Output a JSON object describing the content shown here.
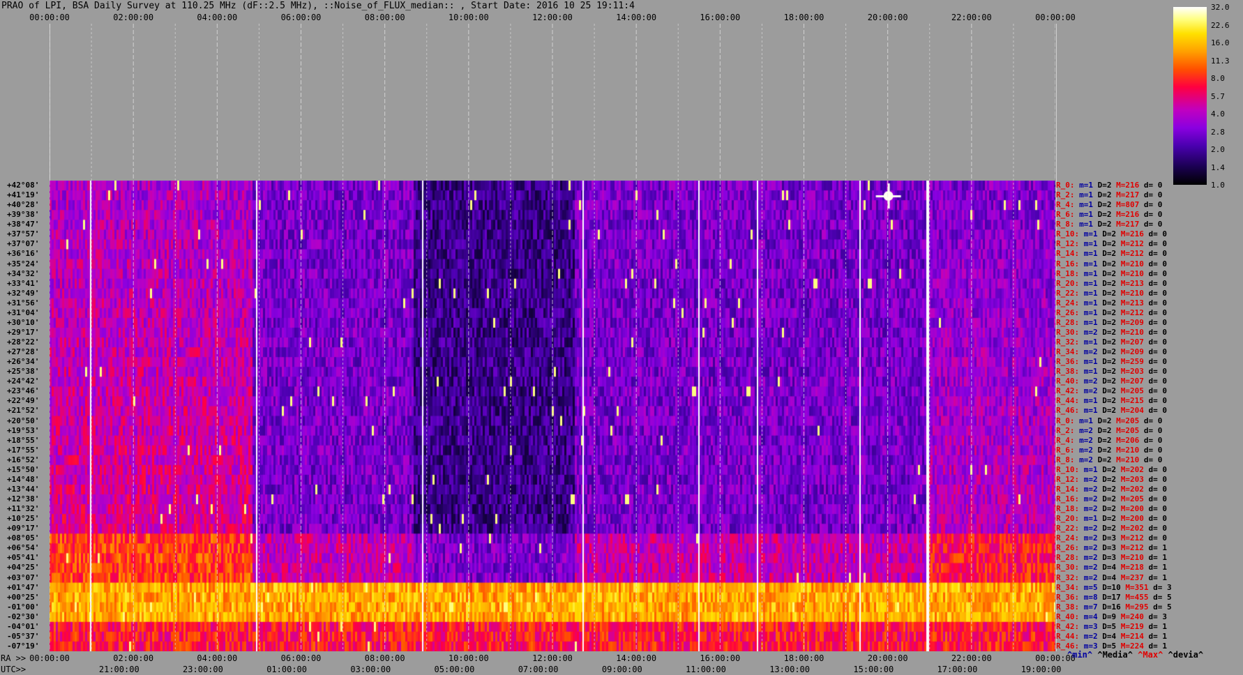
{
  "title": "PRAO of LPI, BSA Daily Survey at 110.25 MHz (dF::2.5 MHz), ::Noise_of_FLUX_median:: , Start Date: 2016 10 25 19:11:4",
  "top_axis": [
    "00:00:00",
    "02:00:00",
    "04:00:00",
    "06:00:00",
    "08:00:00",
    "10:00:00",
    "12:00:00",
    "14:00:00",
    "16:00:00",
    "18:00:00",
    "20:00:00",
    "22:00:00",
    "00:00:00"
  ],
  "bottom_axis_ra_label": "RA >>",
  "bottom_axis_ra": [
    "00:00:00",
    "02:00:00",
    "04:00:00",
    "06:00:00",
    "08:00:00",
    "10:00:00",
    "12:00:00",
    "14:00:00",
    "16:00:00",
    "18:00:00",
    "20:00:00",
    "22:00:00",
    "00:00:00"
  ],
  "bottom_axis_utc_label": "UTC>>",
  "bottom_axis_utc": [
    "21:00:00",
    "23:00:00",
    "01:00:00",
    "03:00:00",
    "05:00:00",
    "07:00:00",
    "09:00:00",
    "11:00:00",
    "13:00:00",
    "15:00:00",
    "17:00:00",
    "19:00:00"
  ],
  "colorbar_ticks": [
    "32.0",
    "22.6",
    "16.0",
    "11.3",
    "8.0",
    "5.7",
    "4.0",
    "2.8",
    "2.0",
    "1.4",
    "1.0"
  ],
  "stat_legend": {
    "min": "^min^",
    "median": "^Media^",
    "max": "^Max^",
    "dev": "^devia^"
  },
  "declinations": [
    "+42°08'",
    "+41°19'",
    "+40°28'",
    "+39°38'",
    "+38°47'",
    "+37°57'",
    "+37°07'",
    "+36°16'",
    "+35°24'",
    "+34°32'",
    "+33°41'",
    "+32°49'",
    "+31°56'",
    "+31°04'",
    "+30°10'",
    "+29°17'",
    "+28°22'",
    "+27°28'",
    "+26°34'",
    "+25°38'",
    "+24°42'",
    "+23°46'",
    "+22°49'",
    "+21°52'",
    "+20°50'",
    "+19°53'",
    "+18°55'",
    "+17°55'",
    "+16°52'",
    "+15°50'",
    "+14°48'",
    "+13°44'",
    "+12°38'",
    "+11°32'",
    "+10°25'",
    "+09°17'",
    "+08°05'",
    "+06°54'",
    "+05°41'",
    "+04°25'",
    "+03°07'",
    "+01°47'",
    "+00°25'",
    "-01°00'",
    "-02°30'",
    "-04°01'",
    "-05°37'",
    "-07°19'"
  ],
  "stats": [
    [
      "R_0:",
      "m=1",
      "D=2",
      "M=216",
      "d= 0"
    ],
    [
      "R_2:",
      "m=1",
      "D=2",
      "M=217",
      "d= 0"
    ],
    [
      "R_4:",
      "m=1",
      "D=2",
      "M=807",
      "d= 0"
    ],
    [
      "R_6:",
      "m=1",
      "D=2",
      "M=216",
      "d= 0"
    ],
    [
      "R_8:",
      "m=1",
      "D=2",
      "M=217",
      "d= 0"
    ],
    [
      "R_10:",
      "m=1",
      "D=2",
      "M=216",
      "d= 0"
    ],
    [
      "R_12:",
      "m=1",
      "D=2",
      "M=212",
      "d= 0"
    ],
    [
      "R_14:",
      "m=1",
      "D=2",
      "M=212",
      "d= 0"
    ],
    [
      "R_16:",
      "m=1",
      "D=2",
      "M=210",
      "d= 0"
    ],
    [
      "R_18:",
      "m=1",
      "D=2",
      "M=210",
      "d= 0"
    ],
    [
      "R_20:",
      "m=1",
      "D=2",
      "M=213",
      "d= 0"
    ],
    [
      "R_22:",
      "m=1",
      "D=2",
      "M=210",
      "d= 0"
    ],
    [
      "R_24:",
      "m=1",
      "D=2",
      "M=213",
      "d= 0"
    ],
    [
      "R_26:",
      "m=1",
      "D=2",
      "M=212",
      "d= 0"
    ],
    [
      "R_28:",
      "m=1",
      "D=2",
      "M=209",
      "d= 0"
    ],
    [
      "R_30:",
      "m=2",
      "D=2",
      "M=210",
      "d= 0"
    ],
    [
      "R_32:",
      "m=1",
      "D=2",
      "M=207",
      "d= 0"
    ],
    [
      "R_34:",
      "m=2",
      "D=2",
      "M=209",
      "d= 0"
    ],
    [
      "R_36:",
      "m=1",
      "D=2",
      "M=259",
      "d= 0"
    ],
    [
      "R_38:",
      "m=1",
      "D=2",
      "M=203",
      "d= 0"
    ],
    [
      "R_40:",
      "m=2",
      "D=2",
      "M=207",
      "d= 0"
    ],
    [
      "R_42:",
      "m=2",
      "D=2",
      "M=205",
      "d= 0"
    ],
    [
      "R_44:",
      "m=1",
      "D=2",
      "M=215",
      "d= 0"
    ],
    [
      "R_46:",
      "m=1",
      "D=2",
      "M=204",
      "d= 0"
    ],
    [
      "R_0:",
      "m=1",
      "D=2",
      "M=205",
      "d= 0"
    ],
    [
      "R_2:",
      "m=2",
      "D=2",
      "M=205",
      "d= 0"
    ],
    [
      "R_4:",
      "m=2",
      "D=2",
      "M=206",
      "d= 0"
    ],
    [
      "R_6:",
      "m=2",
      "D=2",
      "M=210",
      "d= 0"
    ],
    [
      "R_8:",
      "m=2",
      "D=2",
      "M=210",
      "d= 0"
    ],
    [
      "R_10:",
      "m=1",
      "D=2",
      "M=202",
      "d= 0"
    ],
    [
      "R_12:",
      "m=2",
      "D=2",
      "M=203",
      "d= 0"
    ],
    [
      "R_14:",
      "m=2",
      "D=2",
      "M=202",
      "d= 0"
    ],
    [
      "R_16:",
      "m=2",
      "D=2",
      "M=205",
      "d= 0"
    ],
    [
      "R_18:",
      "m=2",
      "D=2",
      "M=200",
      "d= 0"
    ],
    [
      "R_20:",
      "m=1",
      "D=2",
      "M=200",
      "d= 0"
    ],
    [
      "R_22:",
      "m=2",
      "D=2",
      "M=202",
      "d= 0"
    ],
    [
      "R_24:",
      "m=2",
      "D=3",
      "M=212",
      "d= 0"
    ],
    [
      "R_26:",
      "m=2",
      "D=3",
      "M=212",
      "d= 1"
    ],
    [
      "R_28:",
      "m=2",
      "D=3",
      "M=210",
      "d= 1"
    ],
    [
      "R_30:",
      "m=2",
      "D=4",
      "M=218",
      "d= 1"
    ],
    [
      "R_32:",
      "m=2",
      "D=4",
      "M=237",
      "d= 1"
    ],
    [
      "R_34:",
      "m=5",
      "D=10",
      "M=351",
      "d= 3"
    ],
    [
      "R_36:",
      "m=8",
      "D=17",
      "M=455",
      "d= 5"
    ],
    [
      "R_38:",
      "m=7",
      "D=16",
      "M=295",
      "d= 5"
    ],
    [
      "R_40:",
      "m=4",
      "D=9",
      "M=240",
      "d= 3"
    ],
    [
      "R_42:",
      "m=3",
      "D=5",
      "M=219",
      "d= 1"
    ],
    [
      "R_44:",
      "m=2",
      "D=4",
      "M=214",
      "d= 1"
    ],
    [
      "R_46:",
      "m=3",
      "D=5",
      "M=224",
      "d= 1"
    ]
  ],
  "colors": {
    "background": "#9c9c9c",
    "label_red": "#e00000",
    "label_blue": "#0000a0"
  }
}
